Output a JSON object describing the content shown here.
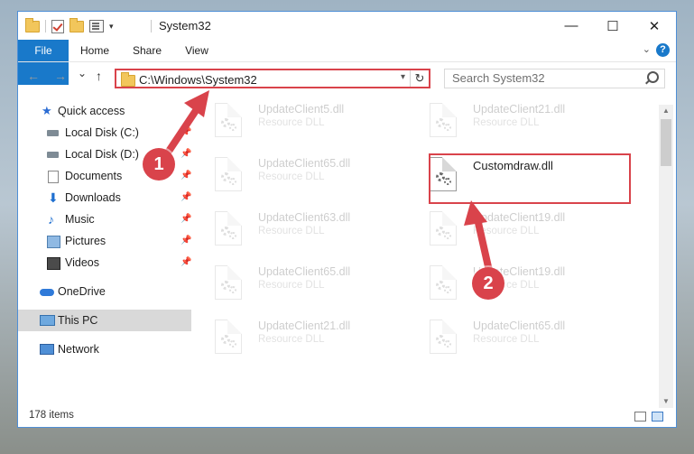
{
  "window": {
    "title": "System32",
    "controls": {
      "minimize": "—",
      "maximize": "☐",
      "close": "✕"
    }
  },
  "ribbon": {
    "tabs": [
      "File",
      "Home",
      "Share",
      "View"
    ],
    "help": "?"
  },
  "navigation": {
    "back": "←",
    "forward": "→",
    "recent": "⌄",
    "up": "↑",
    "address": "C:\\Windows\\System32",
    "refresh": "↻",
    "search_placeholder": "Search System32"
  },
  "sidebar": {
    "items": [
      {
        "label": "Quick access",
        "icon": "star-icon",
        "pinned": false
      },
      {
        "label": "Local Disk (C:)",
        "icon": "drive-icon",
        "pinned": true
      },
      {
        "label": "Local Disk (D:)",
        "icon": "drive-icon",
        "pinned": true
      },
      {
        "label": "Documents",
        "icon": "documents-icon",
        "pinned": true
      },
      {
        "label": "Downloads",
        "icon": "download-icon",
        "pinned": true
      },
      {
        "label": "Music",
        "icon": "music-icon",
        "pinned": true
      },
      {
        "label": "Pictures",
        "icon": "pictures-icon",
        "pinned": true
      },
      {
        "label": "Videos",
        "icon": "videos-icon",
        "pinned": true
      },
      {
        "label": "OneDrive",
        "icon": "onedrive-icon",
        "pinned": false
      },
      {
        "label": "This PC",
        "icon": "this-pc-icon",
        "pinned": false,
        "selected": true
      },
      {
        "label": "Network",
        "icon": "network-icon",
        "pinned": false
      }
    ]
  },
  "files": [
    {
      "name": "UpdateClient5.dll",
      "type": "Resource DLL",
      "faded": true
    },
    {
      "name": "UpdateClient21.dll",
      "type": "Resource DLL",
      "faded": true
    },
    {
      "name": "UpdateClient65.dll",
      "type": "Resource DLL",
      "faded": true
    },
    {
      "name": "Customdraw.dll",
      "type": "",
      "faded": false,
      "highlighted": true
    },
    {
      "name": "UpdateClient63.dll",
      "type": "Resource DLL",
      "faded": true
    },
    {
      "name": "UpdateClient19.dll",
      "type": "Resource DLL",
      "faded": true
    },
    {
      "name": "UpdateClient65.dll",
      "type": "Resource DLL",
      "faded": true
    },
    {
      "name": "UpdateClient19.dll",
      "type": "Resource DLL",
      "faded": true
    },
    {
      "name": "UpdateClient21.dll",
      "type": "Resource DLL",
      "faded": true
    },
    {
      "name": "UpdateClient65.dll",
      "type": "Resource DLL",
      "faded": true
    }
  ],
  "status": {
    "item_count": "178 items"
  },
  "annotations": {
    "step1": "1",
    "step2": "2",
    "color": "#d9434b"
  }
}
